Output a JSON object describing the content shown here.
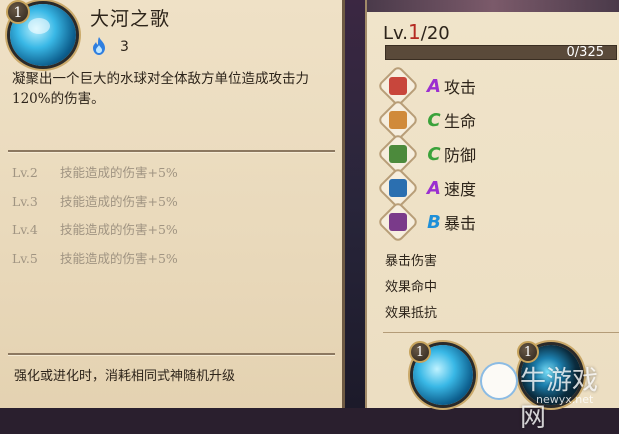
{
  "skill": {
    "level": "1",
    "name": "大河之歌",
    "cost": "3",
    "description": "凝聚出一个巨大的水球对全体敌方单位造成攻击力120%的伤害。",
    "upgrades": [
      {
        "lv": "Lv.2",
        "text": "技能造成的伤害+5%"
      },
      {
        "lv": "Lv.3",
        "text": "技能造成的伤害+5%"
      },
      {
        "lv": "Lv.4",
        "text": "技能造成的伤害+5%"
      },
      {
        "lv": "Lv.5",
        "text": "技能造成的伤害+5%"
      }
    ],
    "footer": "强化或进化时，消耗相同式神随机升级"
  },
  "stats": {
    "level_prefix": "Lv.",
    "level_current": "1",
    "level_max": "/20",
    "xp_text": "0/325",
    "xp_fraction": 0.0,
    "attributes": [
      {
        "icon": "attack-icon",
        "grade": "A",
        "grade_color": "#9b2fd0",
        "label": "攻击",
        "icon_color": "#c8463c"
      },
      {
        "icon": "health-icon",
        "grade": "C",
        "grade_color": "#3aa23a",
        "label": "生命",
        "icon_color": "#d08a3a"
      },
      {
        "icon": "defense-icon",
        "grade": "C",
        "grade_color": "#3aa23a",
        "label": "防御",
        "icon_color": "#4c8a3c"
      },
      {
        "icon": "speed-icon",
        "grade": "A",
        "grade_color": "#9b2fd0",
        "label": "速度",
        "icon_color": "#2b6fb0"
      },
      {
        "icon": "crit-icon",
        "grade": "B",
        "grade_color": "#1e8fd8",
        "label": "暴击",
        "icon_color": "#7a3a8a"
      }
    ],
    "sub_stats": [
      "暴击伤害",
      "效果命中",
      "效果抵抗"
    ]
  },
  "bottom_skills": [
    {
      "level": "1",
      "icon": "water-orb-icon"
    },
    {
      "level": "1",
      "icon": "dark-orb-icon"
    }
  ],
  "watermark": {
    "main": "牛游戏网",
    "sub": "newyx.net"
  }
}
